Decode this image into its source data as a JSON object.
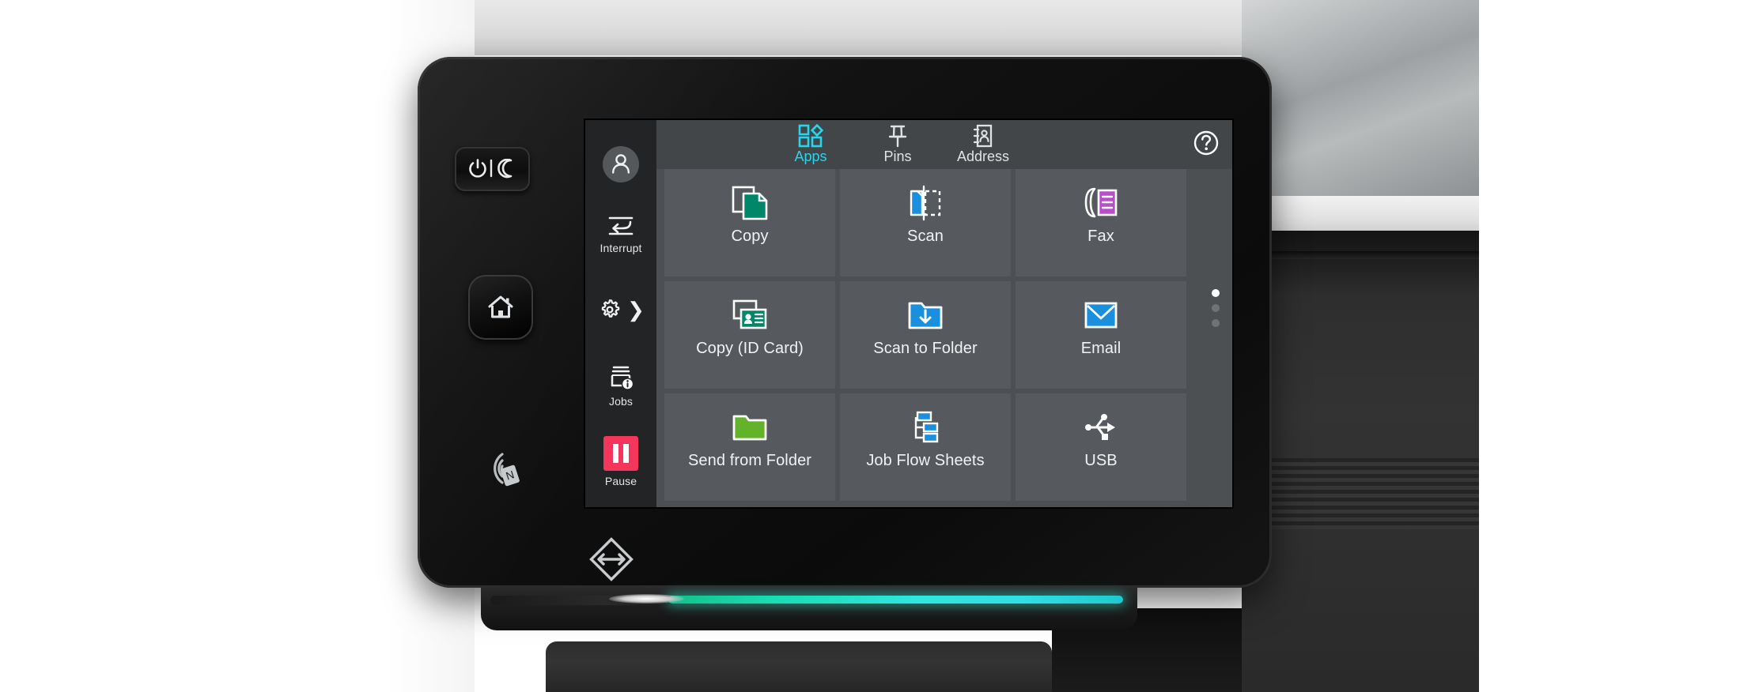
{
  "device": {
    "name": "Xerox multifunction printer control panel",
    "brand_mark": "xerox-logo"
  },
  "hard_keys": [
    {
      "name": "power-sleep-button",
      "icon": "power-moon-icon",
      "label": ""
    },
    {
      "name": "home-button",
      "icon": "home-icon",
      "label": ""
    },
    {
      "name": "nfc-tap-area",
      "icon": "nfc-icon",
      "label": ""
    }
  ],
  "rail": {
    "avatar": {
      "icon": "user-avatar-icon",
      "label": ""
    },
    "items": [
      {
        "id": "interrupt",
        "label": "Interrupt",
        "icon": "interrupt-icon"
      },
      {
        "id": "settings",
        "label": "",
        "icon": "gear-icon",
        "chevron": "❯"
      },
      {
        "id": "jobs",
        "label": "Jobs",
        "icon": "jobs-icon"
      },
      {
        "id": "pause",
        "label": "Pause",
        "icon": "pause-icon"
      }
    ]
  },
  "topbar": {
    "tabs": [
      {
        "id": "apps",
        "label": "Apps",
        "icon": "apps-grid-icon",
        "active": true
      },
      {
        "id": "pins",
        "label": "Pins",
        "icon": "pushpin-icon",
        "active": false
      },
      {
        "id": "address",
        "label": "Address",
        "icon": "address-book-icon",
        "active": false
      }
    ],
    "help": {
      "label": "",
      "icon": "help-question-icon"
    }
  },
  "apps": [
    {
      "label": "Copy",
      "icon": "copy-icon",
      "color": "#00876a"
    },
    {
      "label": "Scan",
      "icon": "scan-icon",
      "color": "#1a8fdd"
    },
    {
      "label": "Fax",
      "icon": "fax-icon",
      "color": "#b64fc8"
    },
    {
      "label": "Copy (ID Card)",
      "icon": "id-card-copy-icon",
      "color": "#00876a"
    },
    {
      "label": "Scan to Folder",
      "icon": "scan-to-folder-icon",
      "color": "#1a8fdd"
    },
    {
      "label": "Email",
      "icon": "email-envelope-icon",
      "color": "#1a8fdd"
    },
    {
      "label": "Send from Folder",
      "icon": "green-folder-icon",
      "color": "#63b32a"
    },
    {
      "label": "Job Flow Sheets",
      "icon": "job-flow-icon",
      "color": "#1a8fdd"
    },
    {
      "label": "USB",
      "icon": "usb-icon",
      "color": "#ffffff"
    }
  ],
  "pagination": {
    "total": 3,
    "active_index": 0
  },
  "status_light": {
    "name": "status-led-bar",
    "color": "#2fe0d8",
    "state": "ready"
  },
  "colors": {
    "accent_cyan": "#25d6ef",
    "screen_bg": "#4d5053",
    "tile_bg": "#565a5e",
    "rail_bg": "#222426",
    "topbar_bg": "#424649",
    "pause_pink": "#f4355c",
    "teal": "#00876a",
    "blue": "#1a8fdd",
    "magenta": "#b64fc8",
    "green": "#63b32a"
  }
}
